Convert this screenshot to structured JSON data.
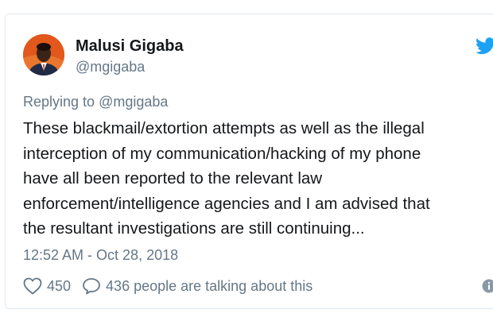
{
  "author": {
    "name": "Malusi Gigaba",
    "handle": "@mgigaba"
  },
  "reply_context": {
    "prefix": "Replying to",
    "mention": "@mgigaba"
  },
  "tweet": {
    "lines": [
      "These blackmail/extortion attempts as well as the illegal",
      "interception of my communication/hacking of my phone",
      "have all been reported to the relevant law",
      "enforcement/intelligence agencies and I am advised that",
      "the resultant investigations are still continuing..."
    ],
    "timestamp": "12:52 AM - Oct 28, 2018"
  },
  "actions": {
    "likes": "450",
    "talking": "436 people are talking about this"
  },
  "icons": {
    "like": "heart-icon",
    "reply": "reply-icon",
    "brand": "twitter-bird-icon",
    "info": "info-icon"
  },
  "colors": {
    "brand": "#1da1f2",
    "text": "#14171a",
    "muted": "#657786",
    "border": "#e1e8ed"
  }
}
